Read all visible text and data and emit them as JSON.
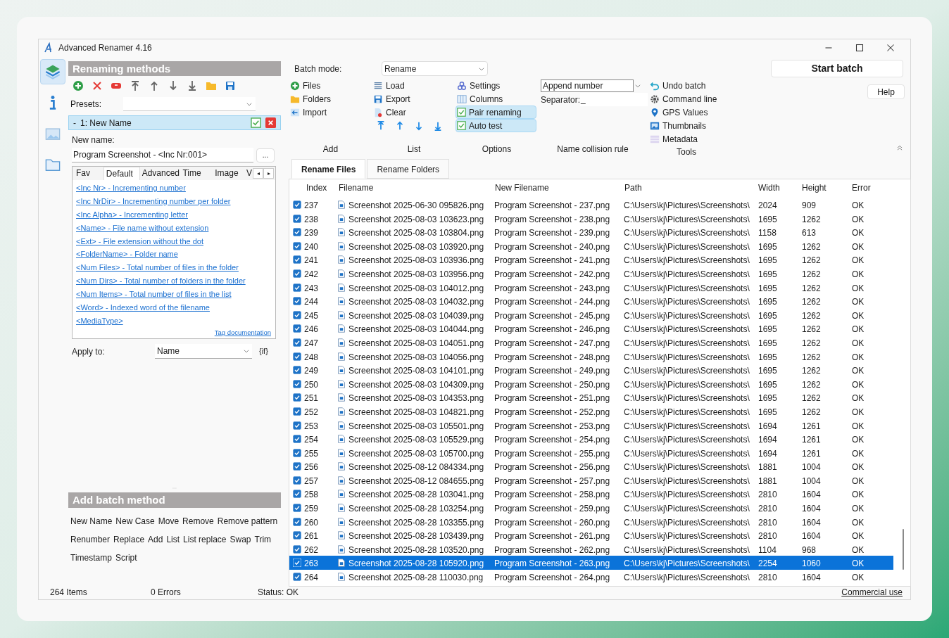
{
  "window": {
    "title": "Advanced Renamer 4.16"
  },
  "sidebar": {
    "items": [
      {
        "selected": true
      },
      {
        "selected": false
      },
      {
        "selected": false
      },
      {
        "selected": false
      }
    ]
  },
  "renaming_methods": {
    "title": "Renaming methods",
    "presets_label": "Presets:",
    "methods": [
      {
        "collapse": "-",
        "label": "1: New Name",
        "enabled": true,
        "selected": true
      }
    ],
    "new_name_label": "New name:",
    "new_name_value": "Program Screenshot - <Inc Nr:001>",
    "browse_button": "...",
    "tag_tabs": [
      {
        "label": "Fav",
        "selected": false
      },
      {
        "label": "Default",
        "selected": true
      },
      {
        "label": "Advanced",
        "selected": false
      },
      {
        "label": "Time",
        "selected": false
      },
      {
        "label": "Image",
        "selected": false
      },
      {
        "label": "V",
        "selected": false
      }
    ],
    "tag_scroll": [
      "◂",
      "▸"
    ],
    "tags": [
      "<Inc Nr> - Incrementing number",
      "<Inc NrDir> - Incrementing number per folder",
      "<Inc Alpha> - Incrementing letter",
      "<Name> - File name without extension",
      "<Ext> - File extension without the dot",
      "<FolderName> - Folder name",
      "<Num Files> - Total number of files in the folder",
      "<Num Dirs> - Total number of folders in the folder",
      "<Num Items> - Total number of files in the list",
      "<Word> - Indexed word of the filename",
      "<MediaType>"
    ],
    "tag_documentation": "Tag documentation",
    "apply_to_label": "Apply to:",
    "apply_to_value": "Name",
    "if_button": "{if}"
  },
  "add_batch_method": {
    "title": "Add batch method",
    "methods": [
      "New Name",
      "New Case",
      "Move",
      "Remove",
      "Remove pattern",
      "Renumber",
      "Replace",
      "Add",
      "List",
      "List replace",
      "Swap",
      "Trim",
      "Timestamp",
      "Script"
    ]
  },
  "ribbon": {
    "batch_mode_label": "Batch mode:",
    "batch_mode_value": "Rename",
    "add": {
      "label": "Add",
      "items": [
        "Files",
        "Folders",
        "Import"
      ]
    },
    "list": {
      "label": "List",
      "items": [
        "Load",
        "Export",
        "Clear"
      ]
    },
    "options": {
      "label": "Options",
      "items": [
        {
          "kind": "button",
          "label": "Settings"
        },
        {
          "kind": "button",
          "label": "Columns"
        },
        {
          "kind": "checkbox",
          "label": "Pair renaming",
          "checked": true
        },
        {
          "kind": "checkbox",
          "label": "Auto test",
          "checked": true
        }
      ]
    },
    "collision": {
      "label": "Name collision rule",
      "value": "Append number",
      "separator_label": "Separator:",
      "separator_value": "_"
    },
    "tools": {
      "label": "Tools",
      "items": [
        "Undo batch",
        "Command line",
        "GPS Values",
        "Thumbnails",
        "Metadata"
      ]
    },
    "start_batch": "Start batch",
    "help": "Help"
  },
  "tabs": [
    {
      "label": "Rename Files",
      "selected": true
    },
    {
      "label": "Rename Folders",
      "selected": false
    }
  ],
  "table": {
    "columns": [
      "Index",
      "Filename",
      "New Filename",
      "Path",
      "Width",
      "Height",
      "Error"
    ],
    "rows": [
      {
        "checked": true,
        "selected": false,
        "cells": [
          "237",
          "Screenshot 2025-06-30 095826.png",
          "Program Screenshot - 237.png",
          "C:\\Users\\kj\\Pictures\\Screenshots\\",
          "2024",
          "909",
          "OK"
        ]
      },
      {
        "checked": true,
        "selected": false,
        "cells": [
          "238",
          "Screenshot 2025-08-03 103623.png",
          "Program Screenshot - 238.png",
          "C:\\Users\\kj\\Pictures\\Screenshots\\",
          "1695",
          "1262",
          "OK"
        ]
      },
      {
        "checked": true,
        "selected": false,
        "cells": [
          "239",
          "Screenshot 2025-08-03 103804.png",
          "Program Screenshot - 239.png",
          "C:\\Users\\kj\\Pictures\\Screenshots\\",
          "1158",
          "613",
          "OK"
        ]
      },
      {
        "checked": true,
        "selected": false,
        "cells": [
          "240",
          "Screenshot 2025-08-03 103920.png",
          "Program Screenshot - 240.png",
          "C:\\Users\\kj\\Pictures\\Screenshots\\",
          "1695",
          "1262",
          "OK"
        ]
      },
      {
        "checked": true,
        "selected": false,
        "cells": [
          "241",
          "Screenshot 2025-08-03 103936.png",
          "Program Screenshot - 241.png",
          "C:\\Users\\kj\\Pictures\\Screenshots\\",
          "1695",
          "1262",
          "OK"
        ]
      },
      {
        "checked": true,
        "selected": false,
        "cells": [
          "242",
          "Screenshot 2025-08-03 103956.png",
          "Program Screenshot - 242.png",
          "C:\\Users\\kj\\Pictures\\Screenshots\\",
          "1695",
          "1262",
          "OK"
        ]
      },
      {
        "checked": true,
        "selected": false,
        "cells": [
          "243",
          "Screenshot 2025-08-03 104012.png",
          "Program Screenshot - 243.png",
          "C:\\Users\\kj\\Pictures\\Screenshots\\",
          "1695",
          "1262",
          "OK"
        ]
      },
      {
        "checked": true,
        "selected": false,
        "cells": [
          "244",
          "Screenshot 2025-08-03 104032.png",
          "Program Screenshot - 244.png",
          "C:\\Users\\kj\\Pictures\\Screenshots\\",
          "1695",
          "1262",
          "OK"
        ]
      },
      {
        "checked": true,
        "selected": false,
        "cells": [
          "245",
          "Screenshot 2025-08-03 104039.png",
          "Program Screenshot - 245.png",
          "C:\\Users\\kj\\Pictures\\Screenshots\\",
          "1695",
          "1262",
          "OK"
        ]
      },
      {
        "checked": true,
        "selected": false,
        "cells": [
          "246",
          "Screenshot 2025-08-03 104044.png",
          "Program Screenshot - 246.png",
          "C:\\Users\\kj\\Pictures\\Screenshots\\",
          "1695",
          "1262",
          "OK"
        ]
      },
      {
        "checked": true,
        "selected": false,
        "cells": [
          "247",
          "Screenshot 2025-08-03 104051.png",
          "Program Screenshot - 247.png",
          "C:\\Users\\kj\\Pictures\\Screenshots\\",
          "1695",
          "1262",
          "OK"
        ]
      },
      {
        "checked": true,
        "selected": false,
        "cells": [
          "248",
          "Screenshot 2025-08-03 104056.png",
          "Program Screenshot - 248.png",
          "C:\\Users\\kj\\Pictures\\Screenshots\\",
          "1695",
          "1262",
          "OK"
        ]
      },
      {
        "checked": true,
        "selected": false,
        "cells": [
          "249",
          "Screenshot 2025-08-03 104101.png",
          "Program Screenshot - 249.png",
          "C:\\Users\\kj\\Pictures\\Screenshots\\",
          "1695",
          "1262",
          "OK"
        ]
      },
      {
        "checked": true,
        "selected": false,
        "cells": [
          "250",
          "Screenshot 2025-08-03 104309.png",
          "Program Screenshot - 250.png",
          "C:\\Users\\kj\\Pictures\\Screenshots\\",
          "1695",
          "1262",
          "OK"
        ]
      },
      {
        "checked": true,
        "selected": false,
        "cells": [
          "251",
          "Screenshot 2025-08-03 104353.png",
          "Program Screenshot - 251.png",
          "C:\\Users\\kj\\Pictures\\Screenshots\\",
          "1695",
          "1262",
          "OK"
        ]
      },
      {
        "checked": true,
        "selected": false,
        "cells": [
          "252",
          "Screenshot 2025-08-03 104821.png",
          "Program Screenshot - 252.png",
          "C:\\Users\\kj\\Pictures\\Screenshots\\",
          "1695",
          "1262",
          "OK"
        ]
      },
      {
        "checked": true,
        "selected": false,
        "cells": [
          "253",
          "Screenshot 2025-08-03 105501.png",
          "Program Screenshot - 253.png",
          "C:\\Users\\kj\\Pictures\\Screenshots\\",
          "1694",
          "1261",
          "OK"
        ]
      },
      {
        "checked": true,
        "selected": false,
        "cells": [
          "254",
          "Screenshot 2025-08-03 105529.png",
          "Program Screenshot - 254.png",
          "C:\\Users\\kj\\Pictures\\Screenshots\\",
          "1694",
          "1261",
          "OK"
        ]
      },
      {
        "checked": true,
        "selected": false,
        "cells": [
          "255",
          "Screenshot 2025-08-03 105700.png",
          "Program Screenshot - 255.png",
          "C:\\Users\\kj\\Pictures\\Screenshots\\",
          "1694",
          "1261",
          "OK"
        ]
      },
      {
        "checked": true,
        "selected": false,
        "cells": [
          "256",
          "Screenshot 2025-08-12 084334.png",
          "Program Screenshot - 256.png",
          "C:\\Users\\kj\\Pictures\\Screenshots\\",
          "1881",
          "1004",
          "OK"
        ]
      },
      {
        "checked": true,
        "selected": false,
        "cells": [
          "257",
          "Screenshot 2025-08-12 084655.png",
          "Program Screenshot - 257.png",
          "C:\\Users\\kj\\Pictures\\Screenshots\\",
          "1881",
          "1004",
          "OK"
        ]
      },
      {
        "checked": true,
        "selected": false,
        "cells": [
          "258",
          "Screenshot 2025-08-28 103041.png",
          "Program Screenshot - 258.png",
          "C:\\Users\\kj\\Pictures\\Screenshots\\",
          "2810",
          "1604",
          "OK"
        ]
      },
      {
        "checked": true,
        "selected": false,
        "cells": [
          "259",
          "Screenshot 2025-08-28 103254.png",
          "Program Screenshot - 259.png",
          "C:\\Users\\kj\\Pictures\\Screenshots\\",
          "2810",
          "1604",
          "OK"
        ]
      },
      {
        "checked": true,
        "selected": false,
        "cells": [
          "260",
          "Screenshot 2025-08-28 103355.png",
          "Program Screenshot - 260.png",
          "C:\\Users\\kj\\Pictures\\Screenshots\\",
          "2810",
          "1604",
          "OK"
        ]
      },
      {
        "checked": true,
        "selected": false,
        "cells": [
          "261",
          "Screenshot 2025-08-28 103439.png",
          "Program Screenshot - 261.png",
          "C:\\Users\\kj\\Pictures\\Screenshots\\",
          "2810",
          "1604",
          "OK"
        ]
      },
      {
        "checked": true,
        "selected": false,
        "cells": [
          "262",
          "Screenshot 2025-08-28 103520.png",
          "Program Screenshot - 262.png",
          "C:\\Users\\kj\\Pictures\\Screenshots\\",
          "1104",
          "968",
          "OK"
        ]
      },
      {
        "checked": true,
        "selected": true,
        "cells": [
          "263",
          "Screenshot 2025-08-28 105920.png",
          "Program Screenshot - 263.png",
          "C:\\Users\\kj\\Pictures\\Screenshots\\",
          "2254",
          "1060",
          "OK"
        ]
      },
      {
        "checked": true,
        "selected": false,
        "cells": [
          "264",
          "Screenshot 2025-08-28 110030.png",
          "Program Screenshot - 264.png",
          "C:\\Users\\kj\\Pictures\\Screenshots\\",
          "2810",
          "1604",
          "OK"
        ]
      }
    ]
  },
  "status_bar": {
    "items": "264 Items",
    "errors": "0 Errors",
    "status": "Status: OK",
    "license": "Commercial use"
  }
}
